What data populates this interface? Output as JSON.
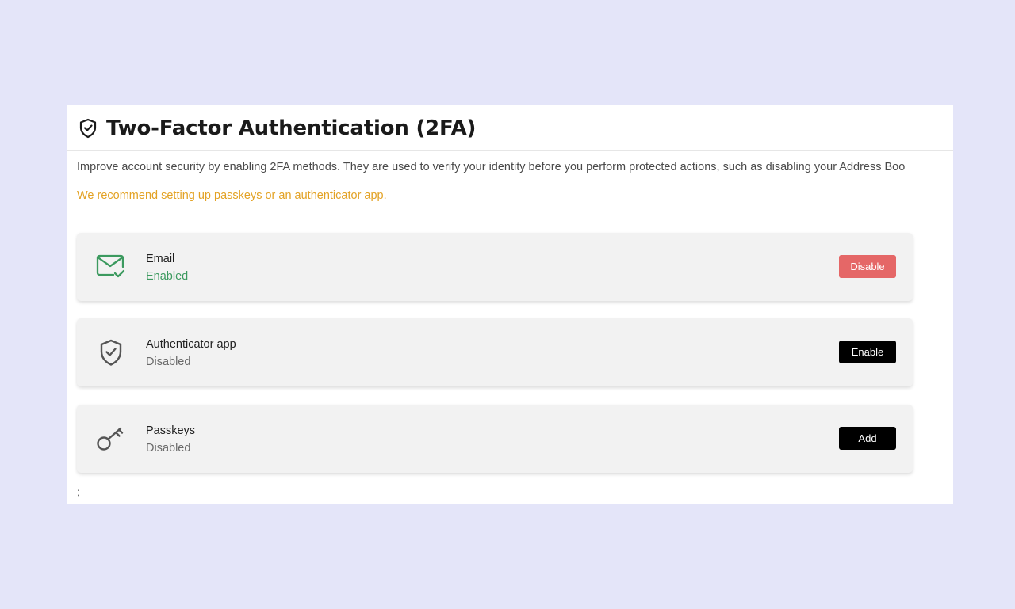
{
  "header": {
    "title": "Two-Factor Authentication (2FA)",
    "icon": "shield-check-icon"
  },
  "description": "Improve account security by enabling 2FA methods. They are used to verify your identity before you perform protected actions, such as disabling your Address Boo",
  "recommendation": "We recommend setting up passkeys or an authenticator app.",
  "methods": [
    {
      "name": "Email",
      "status": "Enabled",
      "icon": "email-check-icon",
      "action_label": "Disable"
    },
    {
      "name": "Authenticator app",
      "status": "Disabled",
      "icon": "shield-check-icon",
      "action_label": "Enable"
    },
    {
      "name": "Passkeys",
      "status": "Disabled",
      "icon": "key-icon",
      "action_label": "Add"
    }
  ],
  "trailing_text": ";",
  "colors": {
    "background": "#e4e5f9",
    "panel": "#ffffff",
    "card": "#f2f2f2",
    "accent_warning": "#e3a224",
    "status_enabled": "#3c9a5f",
    "button_danger": "#e56767",
    "button_dark": "#000000"
  }
}
